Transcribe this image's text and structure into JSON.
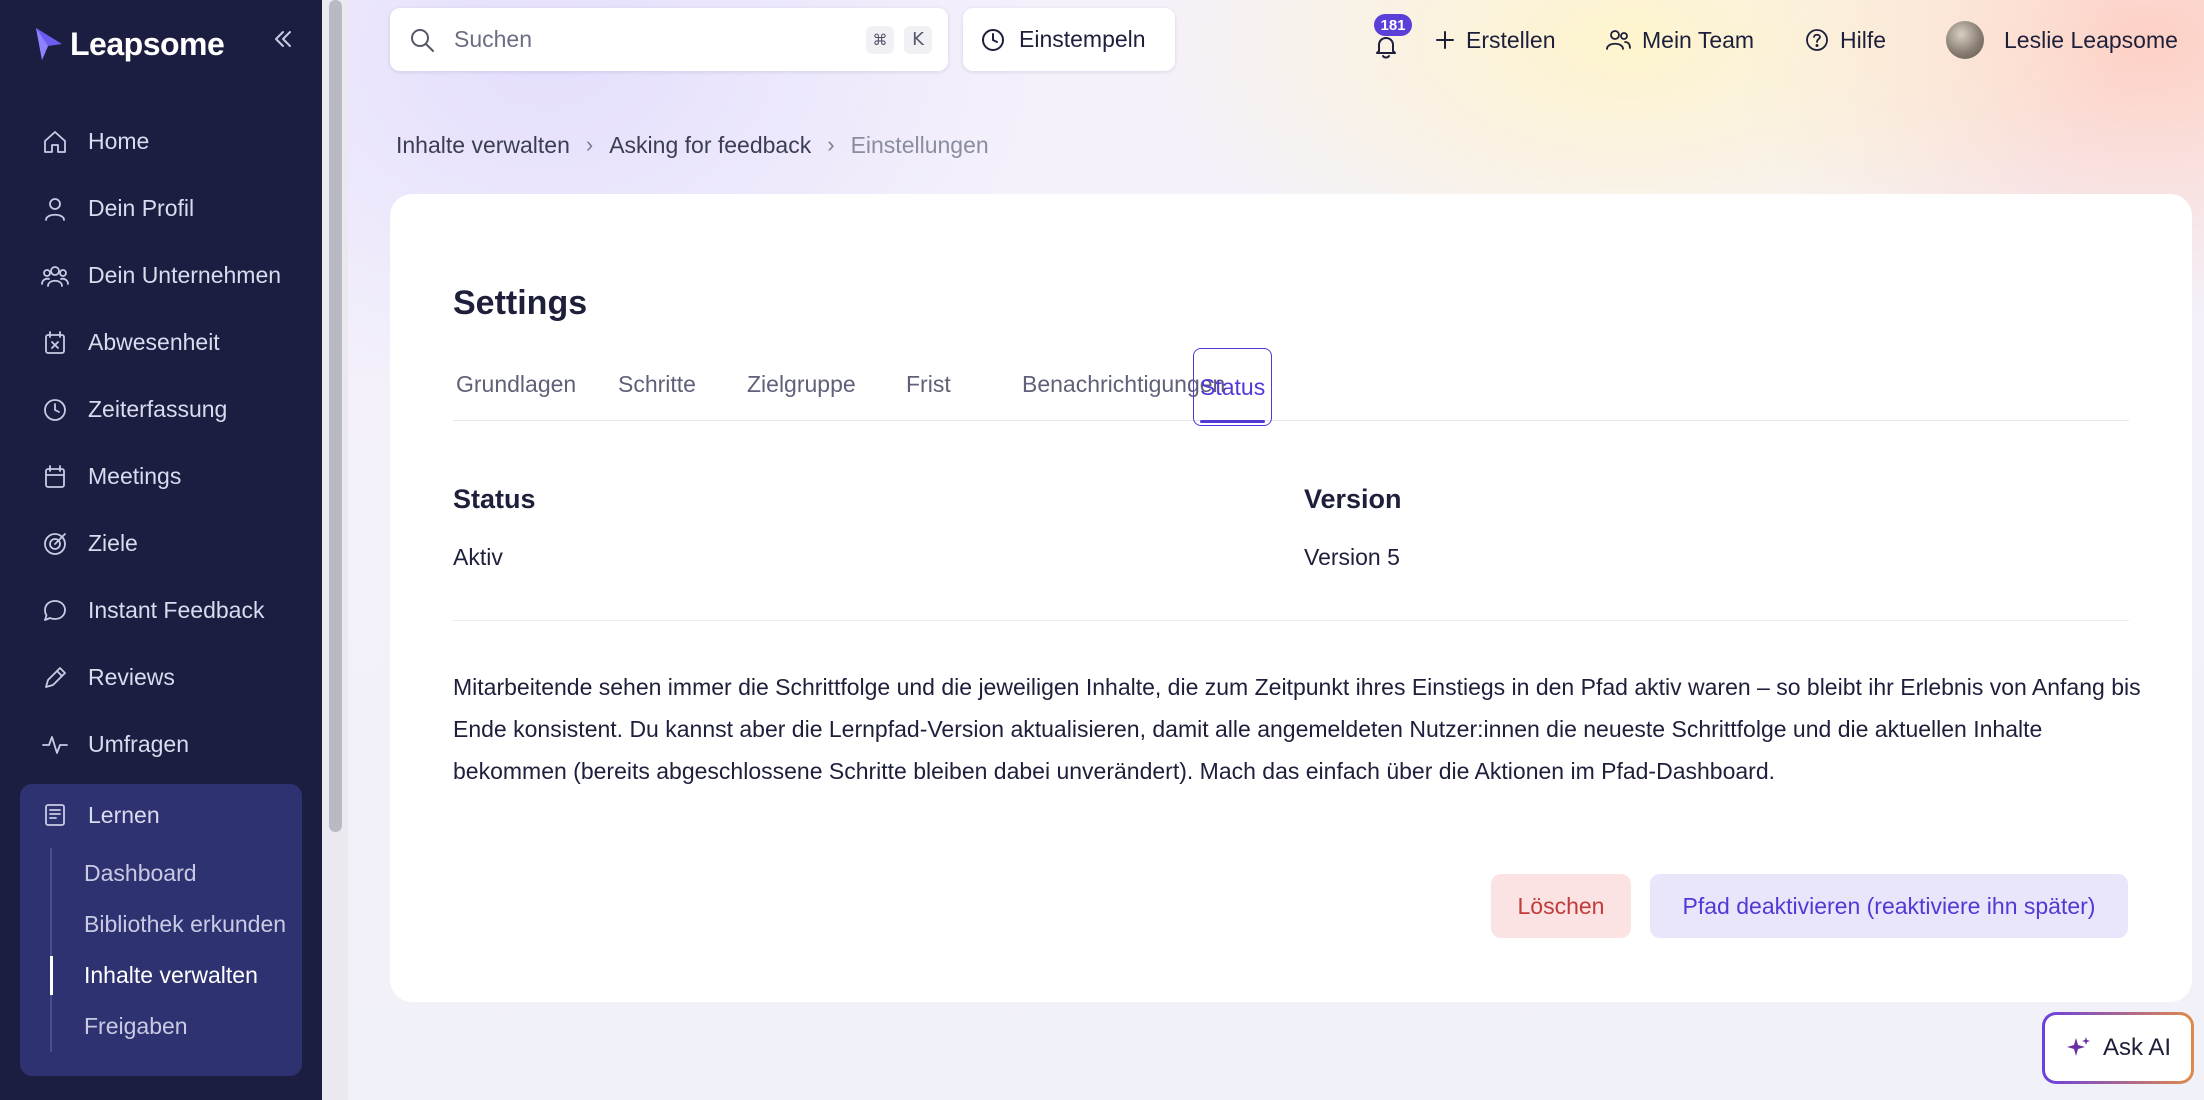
{
  "brand": {
    "name": "Leapsome"
  },
  "sidebar": {
    "items": [
      {
        "label": "Home",
        "icon": "home-icon"
      },
      {
        "label": "Dein Profil",
        "icon": "user-icon"
      },
      {
        "label": "Dein Unternehmen",
        "icon": "users-icon"
      },
      {
        "label": "Abwesenheit",
        "icon": "calendar-x-icon"
      },
      {
        "label": "Zeiterfassung",
        "icon": "clock-icon"
      },
      {
        "label": "Meetings",
        "icon": "calendar-icon"
      },
      {
        "label": "Ziele",
        "icon": "target-icon"
      },
      {
        "label": "Instant Feedback",
        "icon": "chat-icon"
      },
      {
        "label": "Reviews",
        "icon": "pencil-icon"
      },
      {
        "label": "Umfragen",
        "icon": "pulse-icon"
      }
    ],
    "learn": {
      "label": "Lernen",
      "icon": "book-icon",
      "sub": [
        "Dashboard",
        "Bibliothek erkunden",
        "Inhalte verwalten",
        "Freigaben"
      ],
      "active_index": 2
    }
  },
  "topbar": {
    "search_placeholder": "Suchen",
    "shortcut_1": "⌘",
    "shortcut_2": "K",
    "clock_in": "Einstempeln",
    "notifications_count": "181",
    "create": "Erstellen",
    "my_team": "Mein Team",
    "help": "Hilfe",
    "user_name": "Leslie Leapsome"
  },
  "breadcrumb": {
    "first": "Inhalte verwalten",
    "second": "Asking for feedback",
    "current": "Einstellungen"
  },
  "settings": {
    "title": "Settings",
    "tabs": [
      "Grundlagen",
      "Schritte",
      "Zielgruppe",
      "Frist",
      "Benachrichtigungen",
      "Status"
    ],
    "active_tab": "Status",
    "status_label": "Status",
    "status_value": "Aktiv",
    "version_label": "Version",
    "version_value": "Version 5",
    "description": "Mitarbeitende sehen immer die Schrittfolge und die jeweiligen Inhalte, die zum Zeitpunkt ihres Einstiegs in den Pfad aktiv waren – so bleibt ihr Erlebnis von Anfang bis Ende konsistent. Du kannst aber die Lernpfad-Version aktualisieren, damit alle angemeldeten Nutzer:innen die neueste Schrittfolge und die aktuellen Inhalte bekommen (bereits abgeschlossene Schritte bleiben dabei unverändert). Mach das einfach über die Aktionen im Pfad-Dashboard.",
    "delete_label": "Löschen",
    "deactivate_label": "Pfad deaktivieren (reaktiviere ihn später)"
  },
  "ask_ai": {
    "label": "Ask AI"
  },
  "colors": {
    "sidebar_bg": "#1b1e40",
    "accent": "#5338d6",
    "danger": "#c23a3a",
    "badge": "#5b3fd8"
  }
}
